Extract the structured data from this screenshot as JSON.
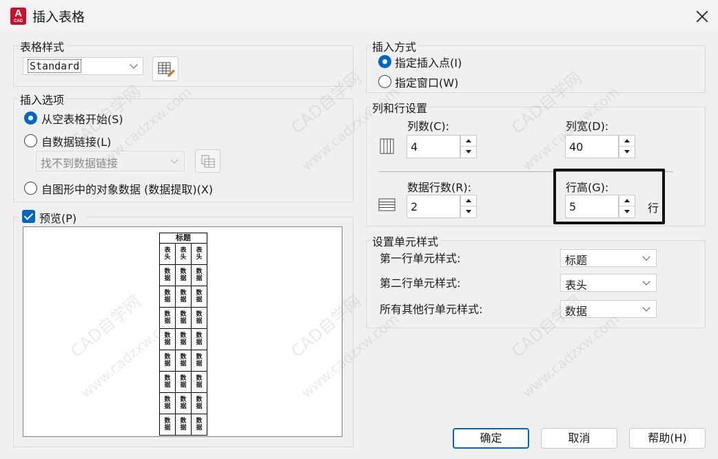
{
  "window": {
    "title": "插入表格",
    "app_icon_letter": "A",
    "app_icon_sub": "CAD"
  },
  "table_style": {
    "legend": "表格样式",
    "selected": "Standard"
  },
  "insert_options": {
    "legend": "插入选项",
    "option_empty": "从空表格开始(S)",
    "option_link": "自数据链接(L)",
    "link_combo": "找不到数据链接",
    "option_extract": "自图形中的对象数据 (数据提取)(X)",
    "selected": "从空表格开始(S)"
  },
  "preview": {
    "label": "预览(P)",
    "checked": true,
    "table": {
      "title": "标题",
      "header": [
        "表头",
        "表头",
        "表头"
      ],
      "cell": "数据",
      "data_rows": 8
    }
  },
  "insertion_method": {
    "legend": "插入方式",
    "option_point": "指定插入点(I)",
    "option_window": "指定窗口(W)",
    "selected": "指定插入点(I)"
  },
  "column_row": {
    "legend": "列和行设置",
    "columns_label": "列数(C):",
    "columns_value": "4",
    "col_width_label": "列宽(D):",
    "col_width_value": "40",
    "data_rows_label": "数据行数(R):",
    "data_rows_value": "2",
    "row_height_label": "行高(G):",
    "row_height_value": "5",
    "row_height_unit": "行"
  },
  "cell_styles": {
    "legend": "设置单元样式",
    "first_row_label": "第一行单元样式:",
    "first_row_value": "标题",
    "second_row_label": "第二行单元样式:",
    "second_row_value": "表头",
    "other_rows_label": "所有其他行单元样式:",
    "other_rows_value": "数据"
  },
  "buttons": {
    "ok": "确定",
    "cancel": "取消",
    "help": "帮助(H)"
  },
  "watermark": {
    "site": "CAD自学网",
    "url": "www.cadzxw.com"
  },
  "colors": {
    "accent": "#0067c0",
    "app_red": "#c8102e"
  }
}
